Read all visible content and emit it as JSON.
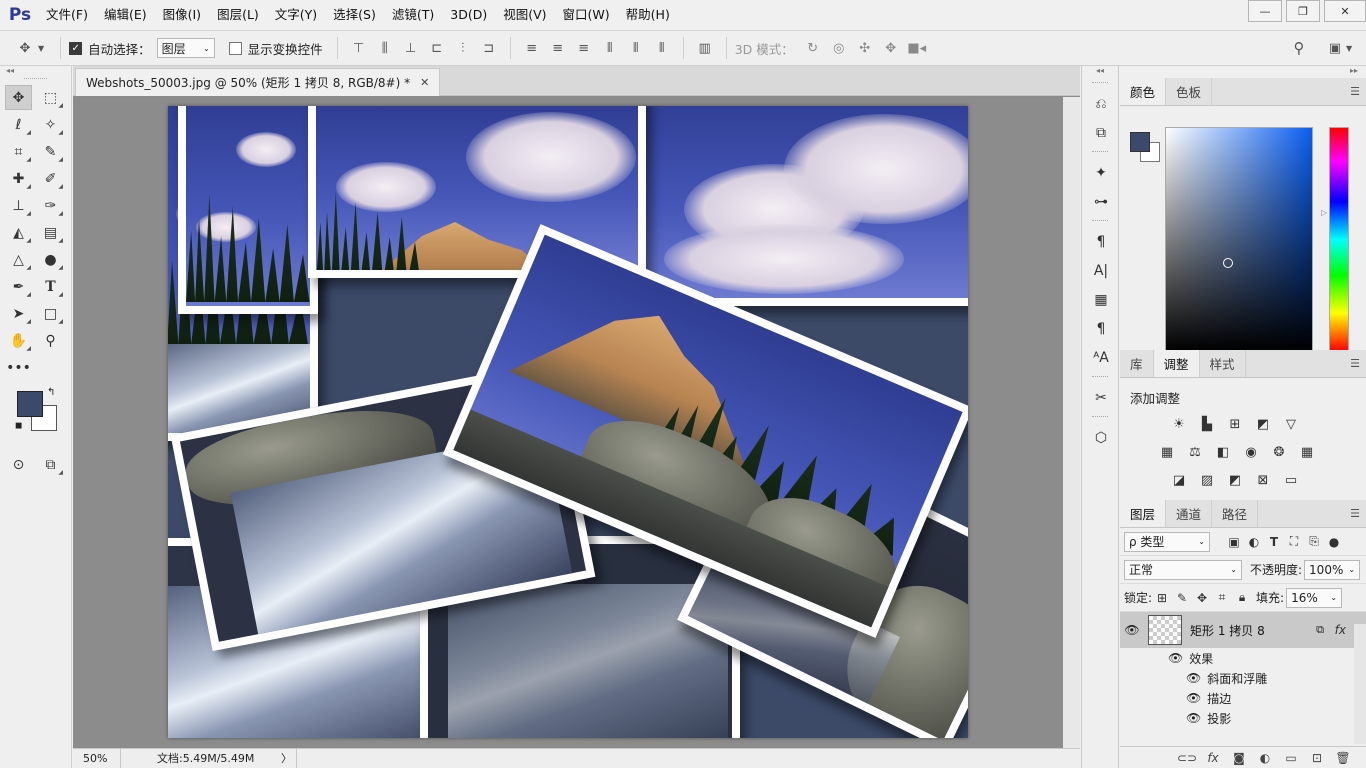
{
  "app": {
    "logo": "Ps"
  },
  "menu": [
    "文件(F)",
    "编辑(E)",
    "图像(I)",
    "图层(L)",
    "文字(Y)",
    "选择(S)",
    "滤镜(T)",
    "3D(D)",
    "视图(V)",
    "窗口(W)",
    "帮助(H)"
  ],
  "window_controls": {
    "minimize": "—",
    "restore": "❐",
    "close": "✕"
  },
  "options": {
    "auto_select_label": "自动选择：",
    "auto_select_checked": true,
    "auto_select_target": "图层",
    "show_transform_label": "显示变换控件",
    "show_transform_checked": false,
    "mode_3d_label": "3D 模式："
  },
  "document": {
    "tab_title": "Webshots_50003.jpg @ 50% (矩形 1 拷贝 8, RGB/8#) *",
    "zoom": "50%",
    "doc_size": "文档:5.49M/5.49M"
  },
  "colors": {
    "foreground": "#3b4a6b",
    "background": "#ffffff"
  },
  "panels": {
    "color_tabs": [
      "颜色",
      "色板"
    ],
    "adjust_tabs": [
      "库",
      "调整",
      "样式"
    ],
    "adjust_title": "添加调整",
    "layers_tabs": [
      "图层",
      "通道",
      "路径"
    ],
    "layer_filter": "ρ 类型",
    "blend_mode": "正常",
    "opacity_label": "不透明度:",
    "opacity_value": "100%",
    "lock_label": "锁定:",
    "fill_label": "填充:",
    "fill_value": "16%",
    "layer": {
      "name": "矩形 1 拷贝 8",
      "fx": "fx",
      "effects_label": "效果",
      "effects": [
        "斜面和浮雕",
        "描边",
        "投影"
      ]
    }
  }
}
